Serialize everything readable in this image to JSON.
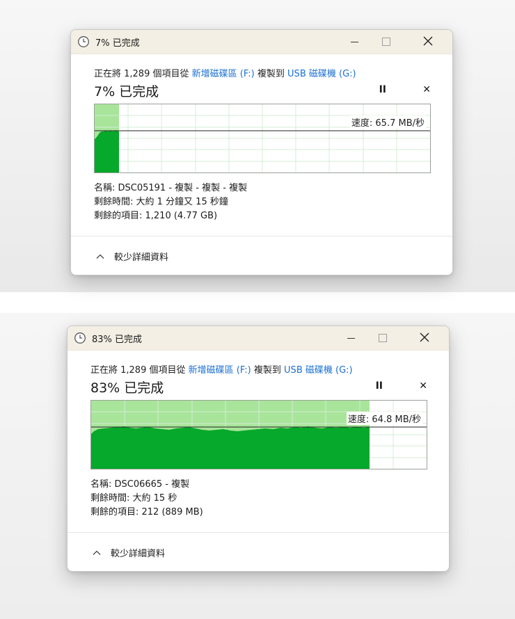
{
  "dialogs": [
    {
      "title": "7% 已完成",
      "route": {
        "prefix": "正在將 1,289 個項目從",
        "source": "新增磁碟區 (F:)",
        "middle": "複製到",
        "destination": "USB 磁碟機 (G:)"
      },
      "percent_text": "7% 已完成",
      "speed_text": "速度: 65.7 MB/秒",
      "progress": 0.07,
      "details": {
        "name": "名稱: DSC05191 - 複製 - 複製 - 複製",
        "time_left": "剩餘時間: 大約 1 分鐘又 15 秒鐘",
        "items_left": "剩餘的項目: 1,210 (4.77 GB)"
      },
      "footer_label": "較少詳細資料"
    },
    {
      "title": "83% 已完成",
      "route": {
        "prefix": "正在將 1,289 個項目從",
        "source": "新增磁碟區 (F:)",
        "middle": "複製到",
        "destination": "USB 磁碟機 (G:)"
      },
      "percent_text": "83% 已完成",
      "speed_text": "速度: 64.8 MB/秒",
      "progress": 0.83,
      "details": {
        "name": "名稱: DSC06665 - 複製",
        "time_left": "剩餘時間: 大約 15 秒",
        "items_left": "剩餘的項目: 212 (889 MB)"
      },
      "footer_label": "較少詳細資料"
    }
  ],
  "controls": {
    "pause_glyph": "II",
    "stop_glyph": "✕",
    "close_glyph": "✕"
  },
  "colors": {
    "accent_link": "#1a6fd3",
    "graph_fill": "#06a92b",
    "graph_progress_bg": "#a8e59a",
    "graph_grid": "#d4ecd6",
    "titlebar": "#f4efe4"
  },
  "icons": {
    "title": "clock-icon",
    "minimize": "minimize-icon",
    "maximize": "maximize-icon",
    "close": "close-icon",
    "pause": "pause-icon",
    "stop": "stop-icon",
    "footer": "chevron-up-icon"
  }
}
